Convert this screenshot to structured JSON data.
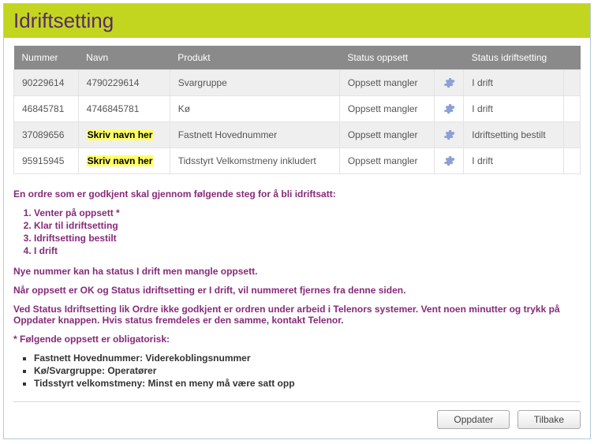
{
  "page_title": "Idriftsetting",
  "table": {
    "headers": {
      "nummer": "Nummer",
      "navn": "Navn",
      "produkt": "Produkt",
      "status_oppsett": "Status oppsett",
      "status_idriftsetting": "Status idriftsetting"
    },
    "rows": [
      {
        "nummer": "90229614",
        "navn": "4790229614",
        "navn_highlight": false,
        "produkt": "Svargruppe",
        "status_oppsett": "Oppsett mangler",
        "status_idriftsetting": "I drift"
      },
      {
        "nummer": "46845781",
        "navn": "4746845781",
        "navn_highlight": false,
        "produkt": "Kø",
        "status_oppsett": "Oppsett mangler",
        "status_idriftsetting": "I drift"
      },
      {
        "nummer": "37089656",
        "navn": "Skriv navn her",
        "navn_highlight": true,
        "produkt": "Fastnett Hovednummer",
        "status_oppsett": "Oppsett mangler",
        "status_idriftsetting": "Idriftsetting bestilt"
      },
      {
        "nummer": "95915945",
        "navn": "Skriv navn her",
        "navn_highlight": true,
        "produkt": "Tidsstyrt Velkomstmeny inkludert",
        "status_oppsett": "Oppsett mangler",
        "status_idriftsetting": "I drift"
      }
    ]
  },
  "info": {
    "intro": "En ordre som er godkjent skal gjennom følgende steg for å bli idriftsatt:",
    "steps": [
      "Venter på oppsett *",
      "Klar til idriftsetting",
      "Idriftsetting bestilt",
      "I drift"
    ],
    "p1": "Nye nummer kan ha status I drift men mangle oppsett.",
    "p2": "Når oppsett er OK og Status idriftsetting er I drift, vil nummeret fjernes fra denne siden.",
    "p3": "Ved Status Idriftsetting lik Ordre ikke godkjent er ordren under arbeid i Telenors systemer. Vent noen minutter og trykk på Oppdater knappen. Hvis status fremdeles er den samme, kontakt Telenor.",
    "p4": "* Følgende oppsett er obligatorisk:",
    "bullets": [
      "Fastnett Hovednummer: Viderekoblingsnummer",
      "Kø/Svargruppe: Operatører",
      "Tidsstyrt velkomstmeny: Minst en meny må være satt opp"
    ]
  },
  "buttons": {
    "oppdater": "Oppdater",
    "tilbake": "Tilbake"
  }
}
